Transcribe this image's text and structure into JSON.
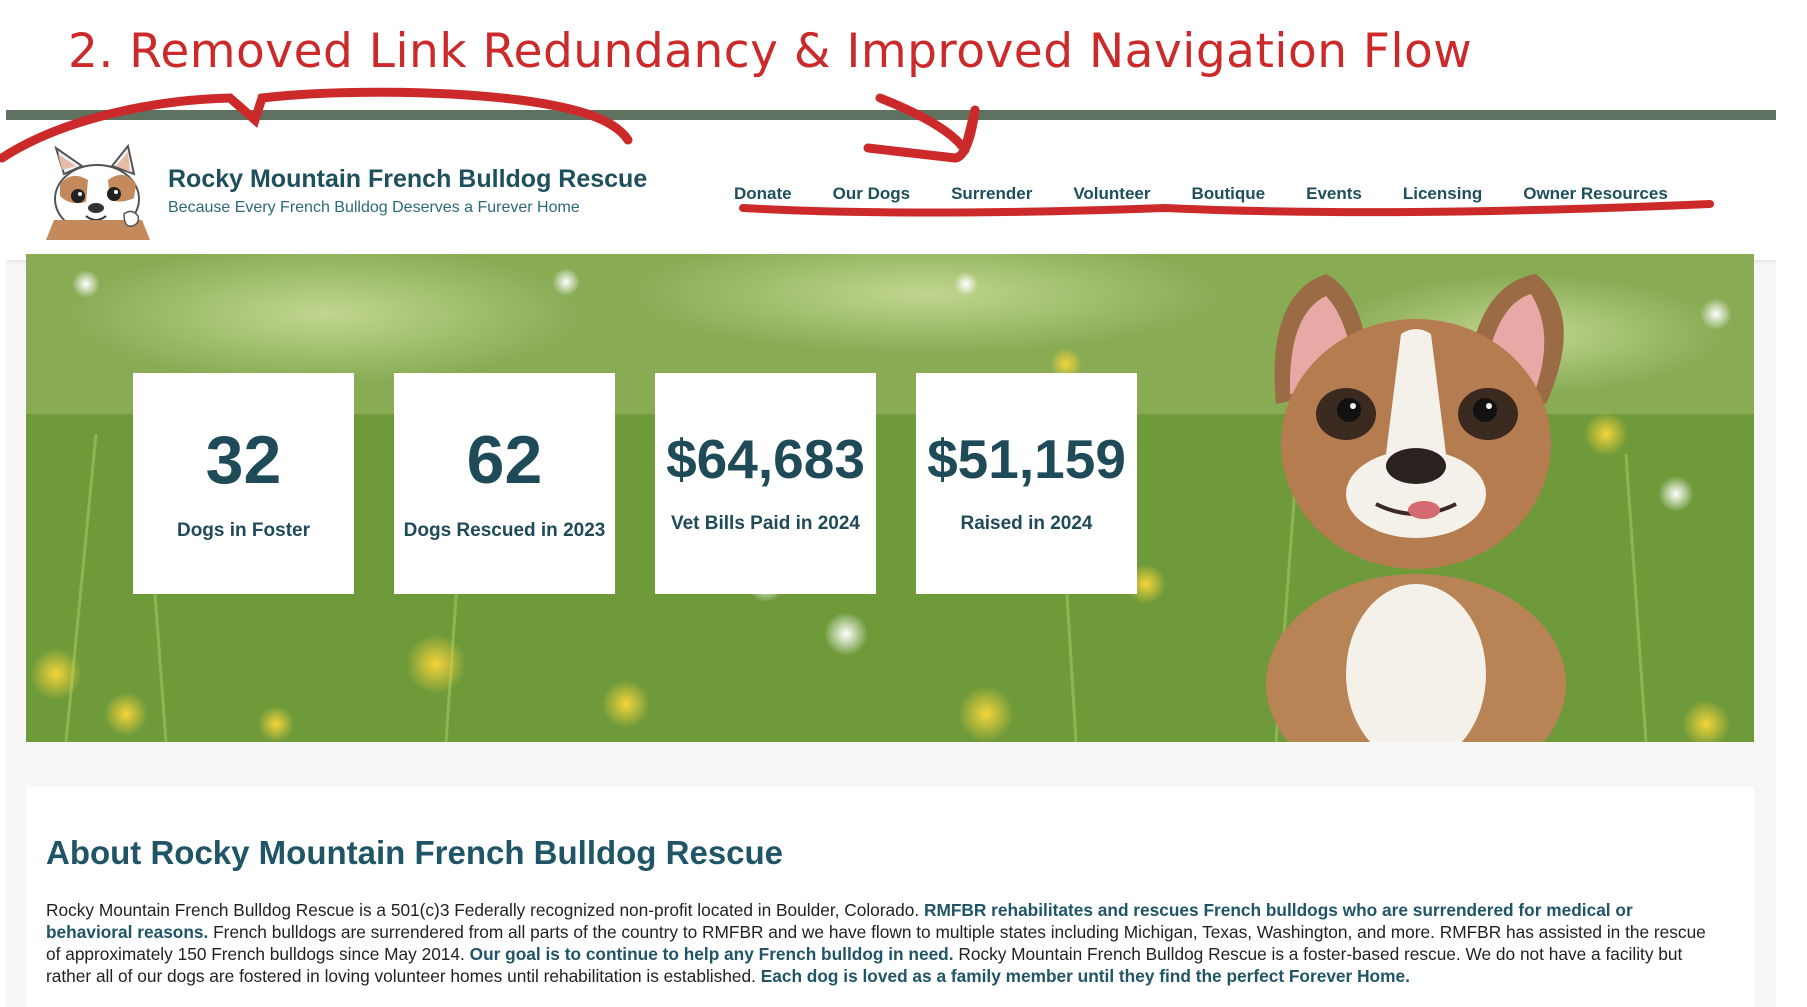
{
  "annotation": {
    "title": "2. Removed Link Redundancy & Improved Navigation Flow",
    "color": "#cc2a2a"
  },
  "header": {
    "logo_icon": "french-bulldog-logo",
    "brand_name": "Rocky Mountain French Bulldog Rescue",
    "tagline": "Because Every French Bulldog Deserves a Furever Home"
  },
  "nav": {
    "items": [
      {
        "label": "Donate"
      },
      {
        "label": "Our Dogs"
      },
      {
        "label": "Surrender"
      },
      {
        "label": "Volunteer"
      },
      {
        "label": "Boutique"
      },
      {
        "label": "Events"
      },
      {
        "label": "Licensing"
      },
      {
        "label": "Owner Resources"
      }
    ]
  },
  "stats": [
    {
      "value": "32",
      "label": "Dogs in Foster"
    },
    {
      "value": "62",
      "label": "Dogs Rescued in 2023"
    },
    {
      "value": "$64,683",
      "label": "Vet Bills Paid in 2024"
    },
    {
      "value": "$51,159",
      "label": "Raised in 2024"
    }
  ],
  "about": {
    "title": "About Rocky Mountain French Bulldog Rescue",
    "p1": "Rocky Mountain French Bulldog Rescue is a 501(c)3 Federally recognized non-profit located in Boulder, Colorado. ",
    "b1": "RMFBR rehabilitates and rescues French bulldogs who are surrendered for medical or behavioral reasons.",
    "p2": " French bulldogs are surrendered from all parts of the country to RMFBR and we have flown to multiple states including Michigan, Texas, Washington, and more. RMFBR has assisted in the rescue of approximately 150 French bulldogs since May 2014. ",
    "b2": "Our goal is to continue to help any French bulldog in need.",
    "p3": " Rocky Mountain French Bulldog Rescue is a foster-based rescue. We do not have a facility but rather all of our dogs are fostered in loving volunteer homes until rehabilitation is established. ",
    "b3": "Each dog is loved as a family member until they find the perfect Forever Home."
  },
  "colors": {
    "brand_teal": "#1d4f5c",
    "top_bar": "#5f7262",
    "markup_red": "#cc2a2a"
  }
}
